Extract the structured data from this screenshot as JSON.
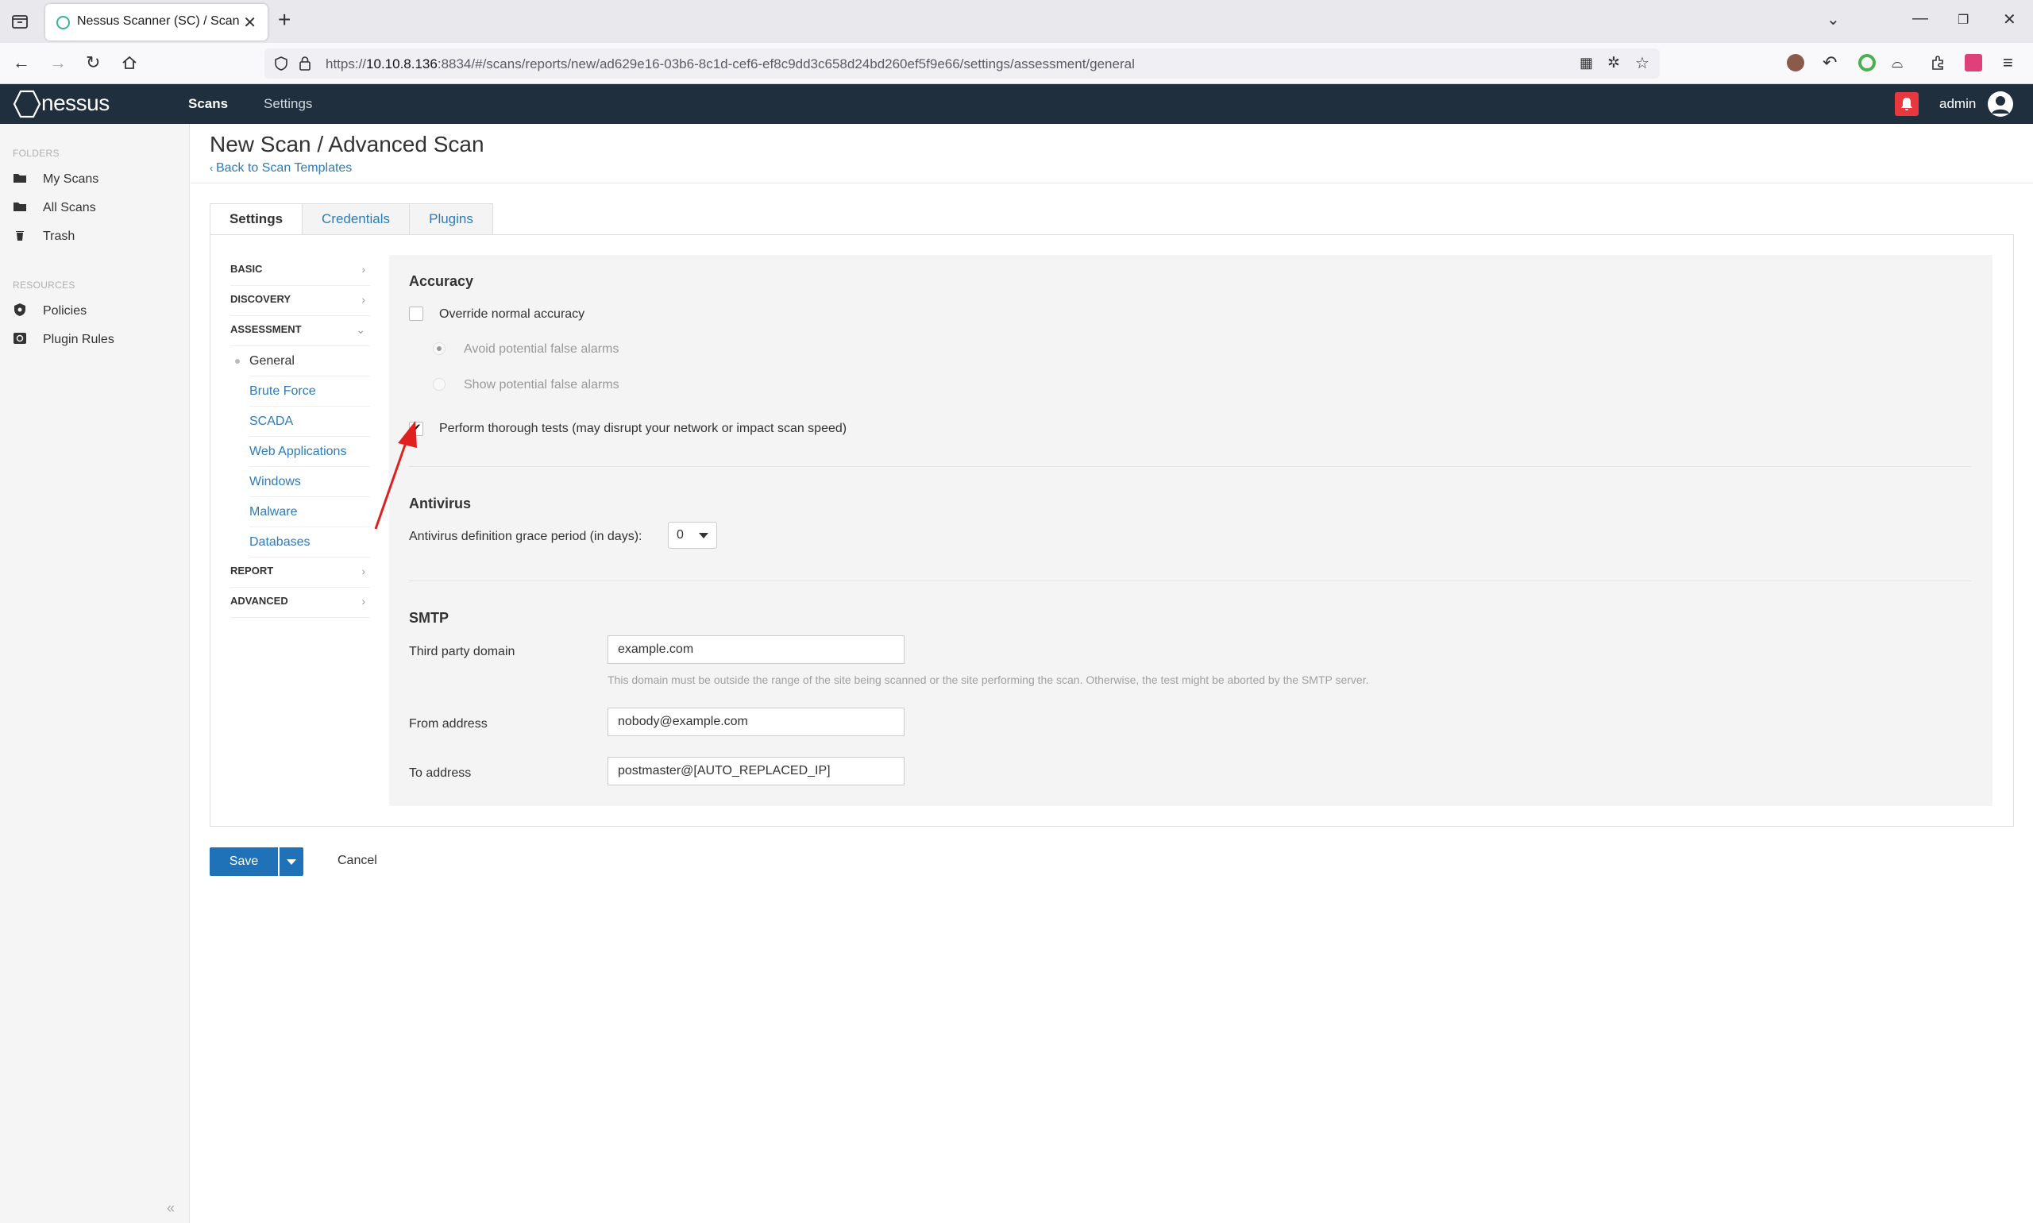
{
  "browser": {
    "tab_title": "Nessus Scanner (SC) / Scans",
    "url_prefix": "https://",
    "url_host": "10.10.8.136",
    "url_rest": ":8834/#/scans/reports/new/ad629e16-03b6-8c1d-cef6-ef8c9dd3c658d24bd260ef5f9e66/settings/assessment/general"
  },
  "header": {
    "logo": "nessus",
    "nav": [
      "Scans",
      "Settings"
    ],
    "user": "admin"
  },
  "sidebar": {
    "folders_label": "FOLDERS",
    "folders": [
      "My Scans",
      "All Scans",
      "Trash"
    ],
    "resources_label": "RESOURCES",
    "resources": [
      "Policies",
      "Plugin Rules"
    ]
  },
  "page": {
    "title": "New Scan / Advanced Scan",
    "back_link": "Back to Scan Templates",
    "tabs": [
      "Settings",
      "Credentials",
      "Plugins"
    ]
  },
  "settings_nav": {
    "basic": "BASIC",
    "discovery": "DISCOVERY",
    "assessment": "ASSESSMENT",
    "assessment_items": [
      "General",
      "Brute Force",
      "SCADA",
      "Web Applications",
      "Windows",
      "Malware",
      "Databases"
    ],
    "report": "REPORT",
    "advanced": "ADVANCED"
  },
  "accuracy": {
    "title": "Accuracy",
    "override_label": "Override normal accuracy",
    "override_checked": false,
    "radio_avoid": "Avoid potential false alarms",
    "radio_show": "Show potential false alarms",
    "thorough_label": "Perform thorough tests (may disrupt your network or impact scan speed)",
    "thorough_checked": true
  },
  "antivirus": {
    "title": "Antivirus",
    "grace_label": "Antivirus definition grace period (in days):",
    "grace_value": "0"
  },
  "smtp": {
    "title": "SMTP",
    "third_party_label": "Third party domain",
    "third_party_value": "example.com",
    "third_party_hint": "This domain must be outside the range of the site being scanned or the site performing the scan. Otherwise, the test might be aborted by the SMTP server.",
    "from_label": "From address",
    "from_value": "nobody@example.com",
    "to_label": "To address",
    "to_value": "postmaster@[AUTO_REPLACED_IP]"
  },
  "footer": {
    "save": "Save",
    "cancel": "Cancel"
  },
  "colors": {
    "header_bg": "#1f2f3d",
    "link": "#2e7bb8",
    "primary_button": "#1f72b8",
    "notification": "#e8383d",
    "annotation_arrow": "#e02020"
  }
}
